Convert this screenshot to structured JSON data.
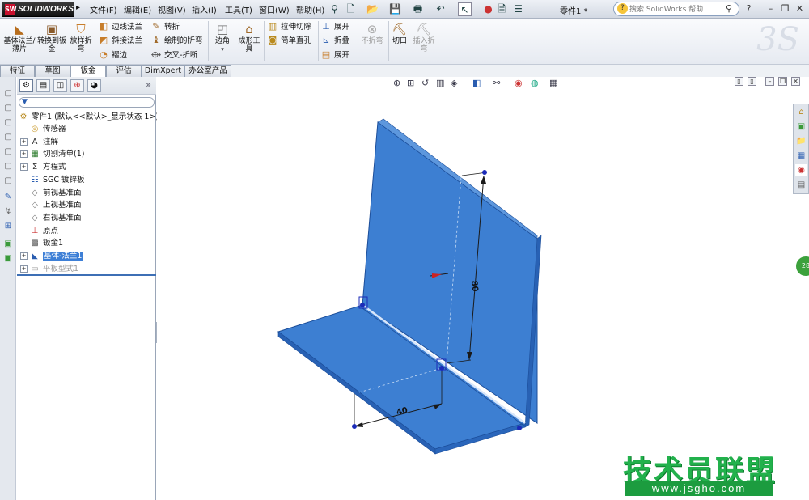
{
  "app": {
    "name": "SOLIDWORKS",
    "document_title": "零件1 *"
  },
  "menu": [
    "文件(F)",
    "编辑(E)",
    "视图(V)",
    "插入(I)",
    "工具(T)",
    "窗口(W)",
    "帮助(H)"
  ],
  "help_search": {
    "placeholder": "搜索 SolidWorks 帮助"
  },
  "commands": {
    "base_flange": "基体法兰/薄片",
    "convert_to_sheet_metal": "转换到钣金",
    "lofted_bend": "放样折弯",
    "edge_flange": "边线法兰",
    "miter_flange": "斜接法兰",
    "hem": "褶边",
    "jog": "转折",
    "sketched_bend": "绘制的折弯",
    "cross_break": "交叉-折断",
    "corners": "边角",
    "forming_tool": "成形工具",
    "extruded_cut": "拉伸切除",
    "simple_hole": "简单直孔",
    "unfold": "展开",
    "fold": "折叠",
    "flatten": "展开",
    "no_bends": "不折弯",
    "rip": "切口",
    "insert_bends": "插入折弯"
  },
  "tabs": [
    "特征",
    "草图",
    "钣金",
    "评估",
    "DimXpert",
    "办公室产品"
  ],
  "active_tab": "钣金",
  "tree": {
    "root": "零件1  (默认<<默认>_显示状态 1>)",
    "items": [
      {
        "label": "传感器",
        "icon": "sensor-icon",
        "expandable": false
      },
      {
        "label": "注解",
        "icon": "annotations-icon",
        "expandable": true
      },
      {
        "label": "切割清单(1)",
        "icon": "cut-list-icon",
        "expandable": true
      },
      {
        "label": "方程式",
        "icon": "equations-icon",
        "expandable": true
      },
      {
        "label": "SGC 镀锌板",
        "icon": "material-icon",
        "expandable": false
      },
      {
        "label": "前视基准面",
        "icon": "plane-icon",
        "expandable": false
      },
      {
        "label": "上视基准面",
        "icon": "plane-icon",
        "expandable": false
      },
      {
        "label": "右视基准面",
        "icon": "plane-icon",
        "expandable": false
      },
      {
        "label": "原点",
        "icon": "origin-icon",
        "expandable": false
      },
      {
        "label": "钣金1",
        "icon": "sheet-metal-icon",
        "expandable": false
      },
      {
        "label": "基体-法兰1",
        "icon": "base-flange-icon",
        "expandable": true,
        "selected": true
      },
      {
        "label": "平板型式1",
        "icon": "flat-pattern-icon",
        "expandable": true,
        "suppressed": true
      }
    ]
  },
  "model": {
    "dimension_height": "80",
    "dimension_length": "40",
    "face_color": "#3a7fd0"
  },
  "side_bubble": "28",
  "watermark": {
    "title": "技术员联盟",
    "url": "www.jsgho.com"
  }
}
